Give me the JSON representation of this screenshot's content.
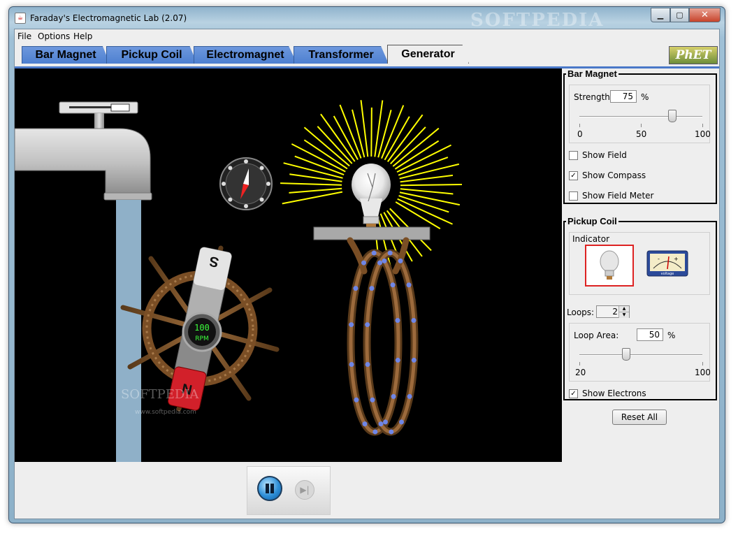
{
  "window": {
    "title": "Faraday's Electromagnetic Lab (2.07)",
    "watermark": "SOFTPEDIA"
  },
  "menu": [
    "File",
    "Options",
    "Help"
  ],
  "tabs": [
    {
      "label": "Bar Magnet"
    },
    {
      "label": "Pickup Coil"
    },
    {
      "label": "Electromagnet"
    },
    {
      "label": "Transformer"
    },
    {
      "label": "Generator",
      "active": true
    }
  ],
  "logo": "PhET",
  "simulation": {
    "rpm_value": "100",
    "rpm_unit": "RPM",
    "watermark": "SOFTPEDIA",
    "watermark_url": "www.softpedia.com",
    "magnet_north": "N",
    "magnet_south": "S"
  },
  "bar_magnet": {
    "title": "Bar Magnet",
    "strength_label": "Strength:",
    "strength_value": "75",
    "strength_unit": "%",
    "strength_fraction": 0.75,
    "ticks": [
      "0",
      "50",
      "100"
    ],
    "show_field": {
      "label": "Show Field",
      "checked": false
    },
    "show_compass": {
      "label": "Show Compass",
      "checked": true
    },
    "show_field_meter": {
      "label": "Show Field Meter",
      "checked": false
    }
  },
  "pickup_coil": {
    "title": "Pickup Coil",
    "indicator_label": "Indicator",
    "indicator_selected": "lightbulb",
    "voltmeter_label": "voltage",
    "loops_label": "Loops:",
    "loops_value": "2",
    "loop_area_label": "Loop Area:",
    "loop_area_value": "50",
    "loop_area_unit": "%",
    "loop_area_fraction": 0.375,
    "loop_area_ticks": [
      "20",
      "100"
    ],
    "show_electrons": {
      "label": "Show Electrons",
      "checked": true
    }
  },
  "reset_all": "Reset All",
  "colors": {
    "tab_blue": "#5a8ad6",
    "canvas": "#000000",
    "rays": "#ffff00",
    "water": "#8fb0c8",
    "selection_red": "#dd2222"
  }
}
